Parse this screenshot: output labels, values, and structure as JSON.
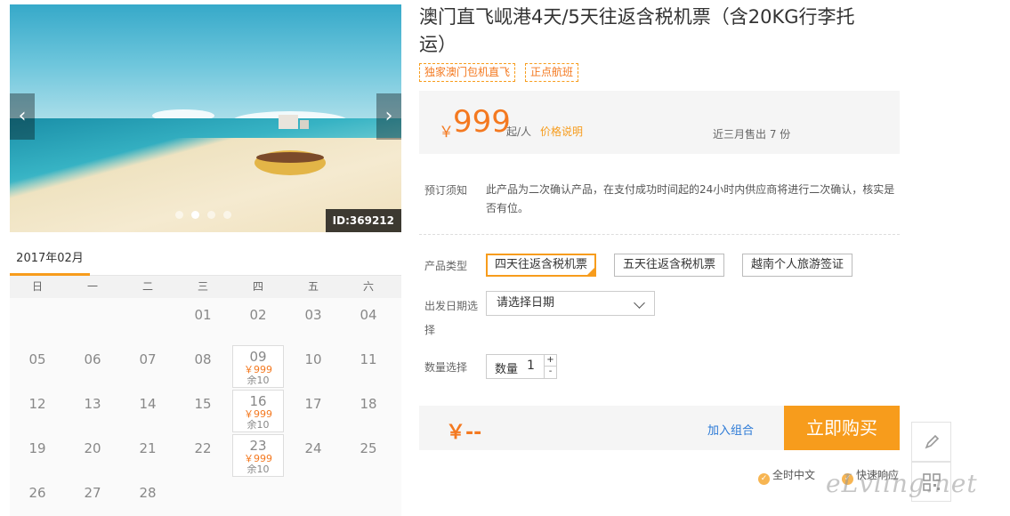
{
  "gallery": {
    "prev_icon": "chevron-left-icon",
    "next_icon": "chevron-right-icon",
    "image_id": "ID:369212",
    "slide_count": 4,
    "active_slide": 2
  },
  "calendar": {
    "month_label": "2017年02月",
    "weekdays": [
      "日",
      "一",
      "二",
      "三",
      "四",
      "五",
      "六"
    ],
    "weeks": [
      [
        {
          "day": ""
        },
        {
          "day": ""
        },
        {
          "day": ""
        },
        {
          "day": "01"
        },
        {
          "day": "02"
        },
        {
          "day": "03"
        },
        {
          "day": "04"
        }
      ],
      [
        {
          "day": "05"
        },
        {
          "day": "06"
        },
        {
          "day": "07"
        },
        {
          "day": "08"
        },
        {
          "day": "09",
          "price": "￥999",
          "stock": "余10"
        },
        {
          "day": "10"
        },
        {
          "day": "11"
        }
      ],
      [
        {
          "day": "12"
        },
        {
          "day": "13"
        },
        {
          "day": "14"
        },
        {
          "day": "15"
        },
        {
          "day": "16",
          "price": "￥999",
          "stock": "余10"
        },
        {
          "day": "17"
        },
        {
          "day": "18"
        }
      ],
      [
        {
          "day": "19"
        },
        {
          "day": "20"
        },
        {
          "day": "21"
        },
        {
          "day": "22"
        },
        {
          "day": "23",
          "price": "￥999",
          "stock": "余10"
        },
        {
          "day": "24"
        },
        {
          "day": "25"
        }
      ],
      [
        {
          "day": "26"
        },
        {
          "day": "27"
        },
        {
          "day": "28"
        },
        {
          "day": ""
        },
        {
          "day": ""
        },
        {
          "day": ""
        },
        {
          "day": ""
        }
      ]
    ]
  },
  "product": {
    "title": "澳门直飞岘港4天/5天往返含税机票（含20KG行李托运）",
    "tags": [
      "独家澳门包机直飞",
      "正点航班"
    ]
  },
  "price": {
    "currency": "￥",
    "amount": "999",
    "unit": "起/人",
    "explain_link": "价格说明",
    "sold": "近三月售出 7 份"
  },
  "notice": {
    "label": "预订须知",
    "text": "此产品为二次确认产品，在支付成功时间起的24小时内供应商将进行二次确认，核实是否有位。"
  },
  "options": {
    "type_label": "产品类型",
    "types": [
      "四天往返含税机票",
      "五天往返含税机票",
      "越南个人旅游签证"
    ],
    "selected_type": 0,
    "date_label": "出发日期选择",
    "date_placeholder": "请选择日期",
    "qty_label": "数量选择",
    "qty_inner_label": "数量",
    "qty_value": "1",
    "plus": "+",
    "minus": "-"
  },
  "buy": {
    "total": "￥--",
    "combo_link": "加入组合",
    "buy_button": "立即购买",
    "services": [
      "全时中文",
      "快速响应"
    ]
  },
  "tools": {
    "edit_icon": "pencil-icon",
    "qr_icon": "qr-code-icon"
  },
  "watermark": "eLvling.net",
  "colors": {
    "accent": "#f79c1c",
    "price": "#f47920",
    "link": "#2c7ad6"
  }
}
